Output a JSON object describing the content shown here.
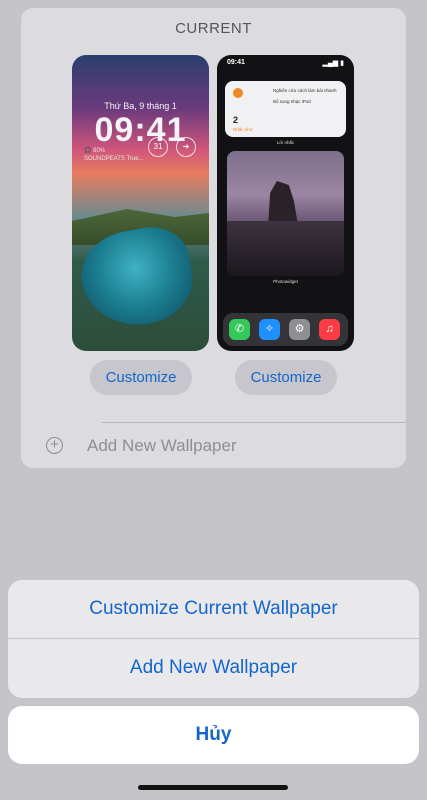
{
  "header": {
    "current_label": "CURRENT"
  },
  "lock_preview": {
    "date": "Thứ Ba, 9 tháng 1",
    "time": "09:41",
    "widget_line1": "🎧 80%",
    "widget_line2": "SOUNDPEATS True...",
    "ring_value": "31"
  },
  "home_preview": {
    "status_time": "09:41",
    "notif_line1": "Nghiên cứu cách làm bài nhanh",
    "notif_line2": "Bổ sung nhạc iPod",
    "notif_count": "2",
    "notif_sub": "Nhắc nhở",
    "widget_label": "Lời nhắc",
    "photo_label": "Photowidget"
  },
  "buttons": {
    "customize_lock": "Customize",
    "customize_home": "Customize",
    "add_new": "Add New Wallpaper"
  },
  "action_sheet": {
    "customize_current": "Customize Current Wallpaper",
    "add_new": "Add New Wallpaper",
    "cancel": "Hủy"
  },
  "colors": {
    "accent": "#1466cc",
    "sheet_bg": "#e9e9ec",
    "dim_bg": "#c4c4c9"
  }
}
